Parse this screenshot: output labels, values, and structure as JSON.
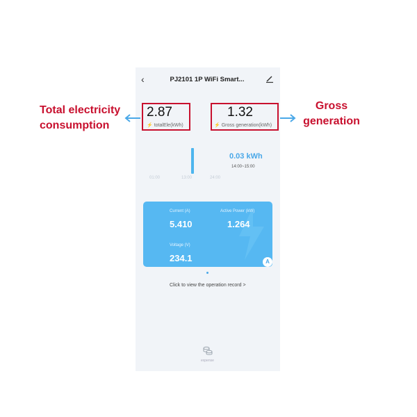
{
  "header": {
    "back_icon": "chevron-left-icon",
    "title": "PJ2101 1P WiFi Smart...",
    "edit_icon": "pencil-icon"
  },
  "stats": {
    "total": {
      "value": "2.87",
      "label": "totalEle(kWh)"
    },
    "gross": {
      "value": "1.32",
      "label": "Gross generation(kWh)"
    }
  },
  "annotations": {
    "left": [
      "Total electricity",
      "consumption"
    ],
    "right": [
      "Gross",
      "generation"
    ],
    "color": "#c8102e"
  },
  "chart": {
    "ticks": [
      "01:00",
      "13:00",
      "24:00"
    ],
    "value": "0.03 kWh",
    "range": "14:00~15:00",
    "bar_color": "#4db5ee"
  },
  "card": {
    "current_label": "Current (A)",
    "current_value": "5.410",
    "power_label": "Active Power (kW)",
    "power_value": "1.264",
    "voltage_label": "Voltage (V)",
    "voltage_value": "234.1",
    "mode_button": "A",
    "color": "#56b8f2"
  },
  "record_link": "Click to view the operation record",
  "record_chevron": ">",
  "expense": {
    "icon": "coins-icon",
    "label": "expense"
  }
}
